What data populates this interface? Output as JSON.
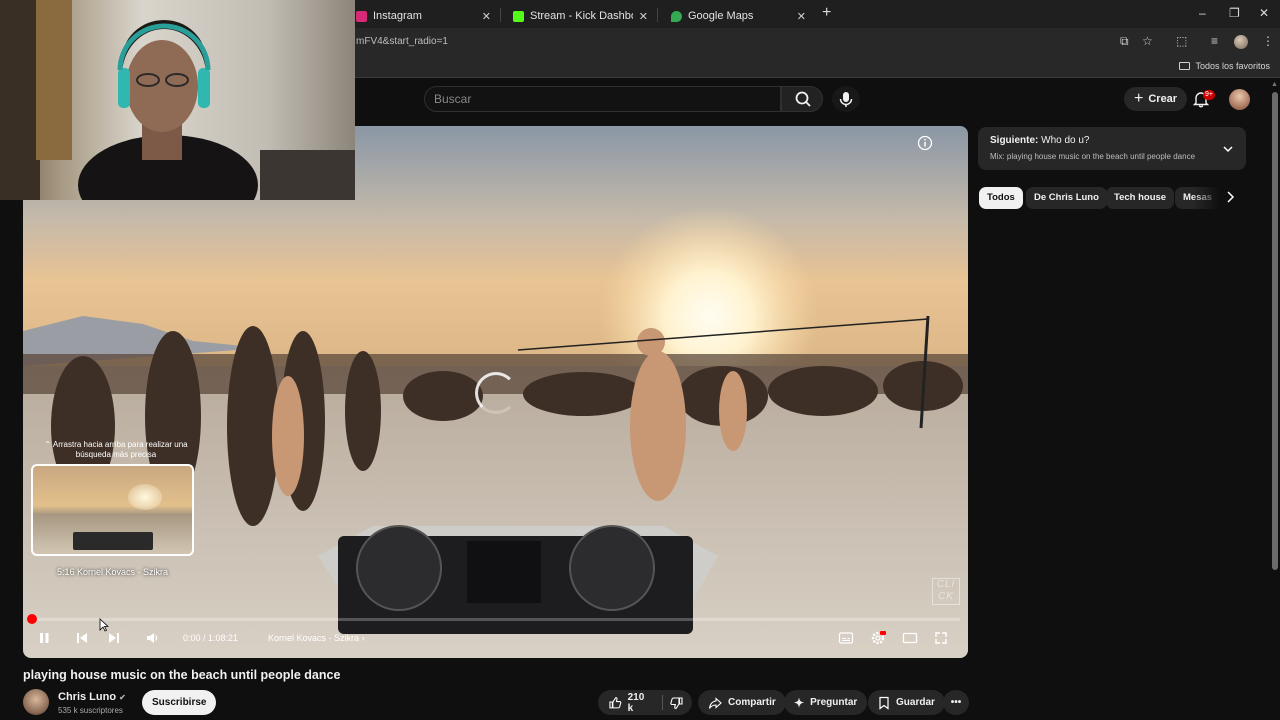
{
  "browser": {
    "tabs": [
      {
        "title": "Instagram",
        "favicon": "instagram-icon",
        "color": "#d62976"
      },
      {
        "title": "Stream - Kick Dashboard",
        "favicon": "kick-icon",
        "color": "#53fc18"
      },
      {
        "title": "Google Maps",
        "favicon": "google-maps-icon",
        "color": "#34a853"
      }
    ],
    "url": "mFV4&start_radio=1",
    "bookmarks_all": "Todos los favoritos"
  },
  "masthead": {
    "search_placeholder": "Buscar",
    "create_label": "Crear",
    "notifications_badge": "9+"
  },
  "player": {
    "seek_hint": "⌃ Arrastra hacia arriba para realizar una búsqueda más precisa",
    "preview_label": "5:16  Kornel Kovacs - Szikra",
    "time": "0:00 / 1:08:21",
    "chapter": "Kornel Kovacs - Szikra",
    "watermark": "CLI CK",
    "progress_fraction": 0.0,
    "accent": "#ff0000"
  },
  "video": {
    "title": "playing house music on the beach until people dance",
    "channel": "Chris Luno",
    "subscribers": "535 k suscriptores",
    "subscribe_label": "Suscribirse",
    "likes": "210 k",
    "share_label": "Compartir",
    "ask_label": "Preguntar",
    "save_label": "Guardar"
  },
  "sidebar": {
    "next_label": "Siguiente:",
    "next_title": "Who do u?",
    "next_mix": "Mix: playing house music on the beach until people dance",
    "chips": [
      "Todos",
      "De Chris Luno",
      "Tech house",
      "Mesas"
    ]
  }
}
